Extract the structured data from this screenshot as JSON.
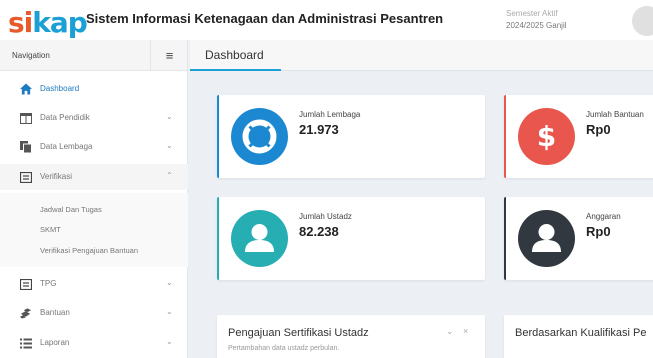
{
  "header": {
    "logo": "sikap",
    "title": "Sistem Informasi Ketenagaan dan Administrasi Pesantren",
    "semester_label": "Semester Aktif",
    "semester_value": "2024/2025 Ganjil"
  },
  "sidebar": {
    "nav_label": "Navigation",
    "toggle_icon": "≡",
    "items": [
      {
        "label": "Dashboard",
        "icon": "home-icon",
        "active": true
      },
      {
        "label": "Data Pendidik",
        "icon": "table-icon",
        "chevron": "⌄"
      },
      {
        "label": "Data Lembaga",
        "icon": "copy-icon",
        "chevron": "⌄"
      },
      {
        "label": "Verifikasi",
        "icon": "list-box-icon",
        "chevron": "⌃"
      },
      {
        "label": "TPG",
        "icon": "list-box-icon",
        "chevron": "⌄"
      },
      {
        "label": "Bantuan",
        "icon": "cubes-icon",
        "chevron": "⌄"
      },
      {
        "label": "Laporan",
        "icon": "list-icon",
        "chevron": "⌄"
      }
    ],
    "submenu": [
      "Jadwal Dan Tugas",
      "SKMT",
      "Verifikasi Pengajuan Bantuan"
    ]
  },
  "tabs": [
    "Dashboard"
  ],
  "stats": [
    {
      "label": "Jumlah Lembaga",
      "value": "21.973",
      "icon": "life-ring-icon",
      "color": "#1b88d1"
    },
    {
      "label": "Jumlah Bantuan",
      "value": "Rp0",
      "icon": "dollar-icon",
      "color": "#e8564d"
    },
    {
      "label": "Jumlah Ustadz",
      "value": "82.238",
      "icon": "user-icon",
      "color": "#26aeb2"
    },
    {
      "label": "Anggaran",
      "value": "Rp0",
      "icon": "user-icon",
      "color": "#323840"
    }
  ],
  "panels": [
    {
      "title": "Pengajuan Sertifikasi Ustadz",
      "subtitle": "Pertambahan data ustadz perbulan.",
      "minimize": "⌄",
      "close": "×"
    },
    {
      "title": "Berdasarkan Kualifikasi Pe"
    }
  ],
  "colors": {
    "accent": "#1ba0d6",
    "logo_orange": "#e65a2b",
    "background": "#ecf0f5"
  }
}
